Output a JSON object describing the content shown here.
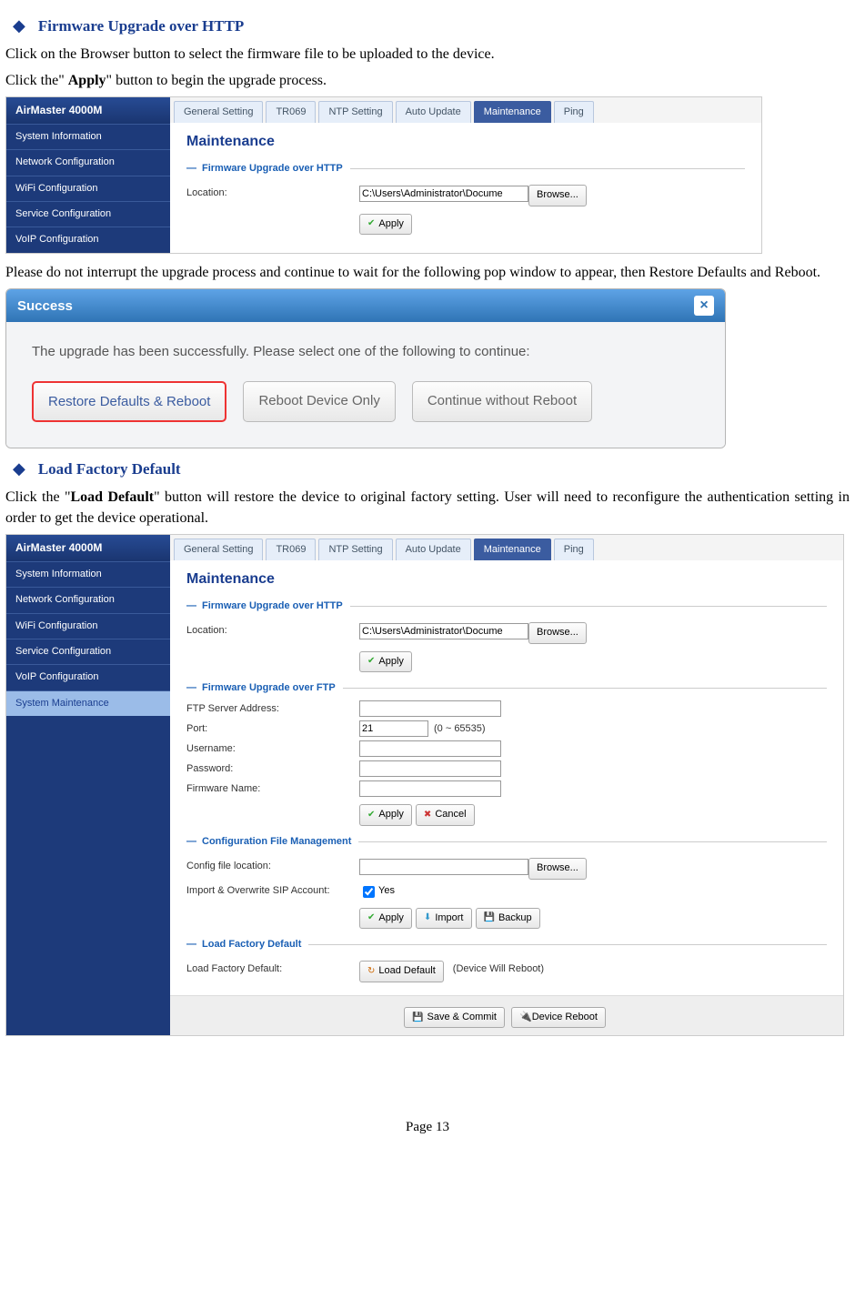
{
  "headings": {
    "h1": "Firmware Upgrade over HTTP",
    "h2": "Load Factory Default"
  },
  "paras": {
    "p1": "Click on the Browser button to select the firmware file to be uploaded to the device.",
    "p2a": "Click the\" ",
    "p2b": "Apply",
    "p2c": "\" button to begin the upgrade process.",
    "p3": "Please do not interrupt the upgrade process and continue to wait for the following pop window to appear, then Restore Defaults and Reboot.",
    "p4a": "Click the \"",
    "p4b": "Load Default",
    "p4c": "\" button will restore the device to original factory setting. User will need to reconfigure the authentication setting in order to get the device operational."
  },
  "adminTitle": "AirMaster 4000M",
  "sideItems": [
    "System Information",
    "Network Configuration",
    "WiFi Configuration",
    "Service Configuration",
    "VoIP Configuration",
    "System Maintenance"
  ],
  "tabs": [
    "General Setting",
    "TR069",
    "NTP Setting",
    "Auto Update",
    "Maintenance",
    "Ping"
  ],
  "pageTitle": "Maintenance",
  "sections": {
    "s1": "Firmware Upgrade over HTTP",
    "s2": "Firmware Upgrade over FTP",
    "s3": "Configuration File Management",
    "s4": "Load Factory Default"
  },
  "labels": {
    "location": "Location:",
    "ftpServer": "FTP Server Address:",
    "port": "Port:",
    "portRange": "(0 ~ 65535)",
    "username": "Username:",
    "password": "Password:",
    "fwName": "Firmware Name:",
    "cfgLoc": "Config file location:",
    "sipAcct": "Import & Overwrite SIP Account:",
    "yes": "Yes",
    "loadDef": "Load Factory Default:",
    "rebootNote": "(Device Will Reboot)"
  },
  "values": {
    "locationPath": "C:\\Users\\Administrator\\Docume",
    "port": "21"
  },
  "buttons": {
    "browse": "Browse...",
    "apply": "Apply",
    "cancel": "Cancel",
    "import": "Import",
    "backup": "Backup",
    "loadDefault": "Load Default",
    "saveCommit": "Save & Commit",
    "deviceReboot": "Device Reboot"
  },
  "dialog": {
    "title": "Success",
    "text": "The upgrade has been successfully. Please select one of the following to continue:",
    "b1": "Restore Defaults & Reboot",
    "b2": "Reboot Device Only",
    "b3": "Continue without Reboot"
  },
  "footer": "Page 13"
}
